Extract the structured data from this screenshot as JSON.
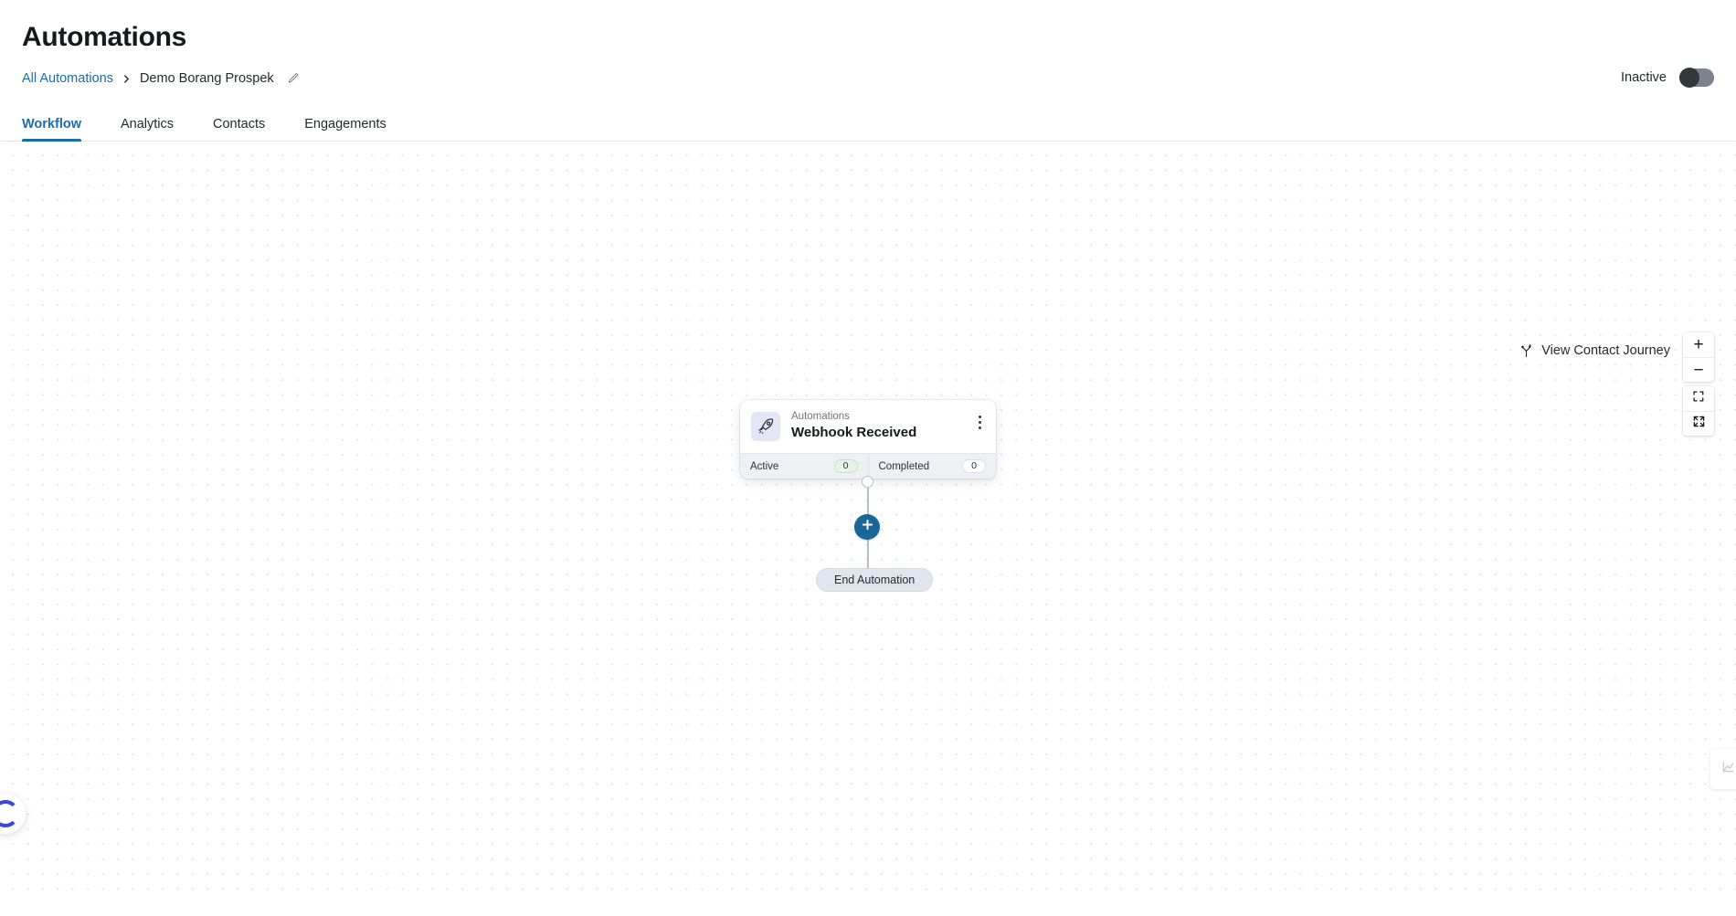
{
  "header": {
    "title": "Automations",
    "breadcrumb": {
      "root_label": "All Automations",
      "separator": "❯",
      "current_label": "Demo Borang Prospek",
      "edit_icon": "pencil-icon"
    },
    "status": {
      "label": "Inactive",
      "toggle_state": "off"
    }
  },
  "tabs": [
    {
      "label": "Workflow",
      "active": true
    },
    {
      "label": "Analytics",
      "active": false
    },
    {
      "label": "Contacts",
      "active": false
    },
    {
      "label": "Engagements",
      "active": false
    }
  ],
  "canvas": {
    "journey_link": {
      "label": "View Contact Journey",
      "icon": "branch-journey-icon"
    },
    "zoom_controls": [
      {
        "name": "zoom-in-button",
        "icon": "plus-icon",
        "label": "+"
      },
      {
        "name": "zoom-out-button",
        "icon": "minus-icon",
        "label": "−"
      },
      {
        "name": "fit-view-button",
        "icon": "fit-view-icon",
        "label": ""
      },
      {
        "name": "expand-button",
        "icon": "expand-arrows-icon",
        "label": ""
      }
    ],
    "minimap_toggle_icon": "minimap-icon",
    "loading_widget_icon": "spinner-icon"
  },
  "workflow": {
    "trigger_node": {
      "icon": "rocket-icon",
      "kicker": "Automations",
      "title": "Webhook Received",
      "menu_icon": "more-vertical-icon",
      "stats": [
        {
          "label": "Active",
          "value": "0",
          "style": "green"
        },
        {
          "label": "Completed",
          "value": "0",
          "style": "white"
        }
      ]
    },
    "add_step_button": {
      "icon": "plus-circle-icon",
      "label": "+"
    },
    "end_node": {
      "label": "End Automation"
    }
  },
  "colors": {
    "accent_blue": "#1b6ca8",
    "add_button_blue": "#1a6698",
    "node_icon_bg": "#e4e6f6",
    "stats_bg": "#eef1f4",
    "active_pill_bg": "#e6f4e7",
    "end_node_bg": "#dfe6ed",
    "spinner_blue": "#3b46d6",
    "toggle_track": "#7c838d",
    "toggle_knob": "#33383d"
  }
}
